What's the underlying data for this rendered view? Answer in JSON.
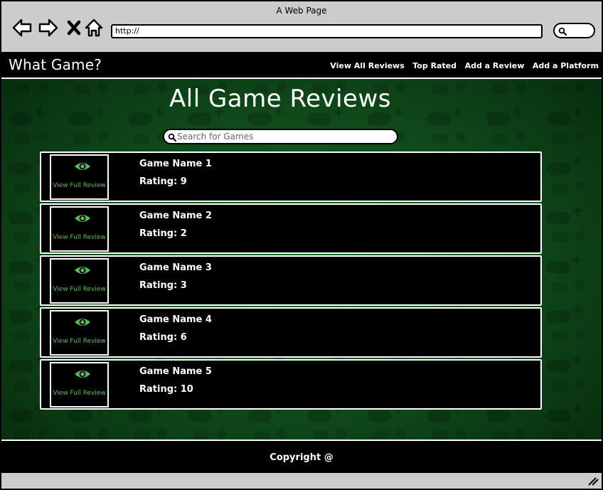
{
  "browser": {
    "title": "A Web Page",
    "url": "http://"
  },
  "site": {
    "logo": "What Game?",
    "nav": [
      {
        "label": "View All Reviews"
      },
      {
        "label": "Top Rated"
      },
      {
        "label": "Add a Review"
      },
      {
        "label": "Add a Platform"
      }
    ]
  },
  "main": {
    "title": "All Game Reviews",
    "search_placeholder": "Search for Games"
  },
  "reviews": [
    {
      "name": "Game Name 1",
      "rating": "Rating: 9",
      "link": "View Full Review"
    },
    {
      "name": "Game Name 2",
      "rating": "Rating: 2",
      "link": "View Full Review"
    },
    {
      "name": "Game Name 3",
      "rating": "Rating: 3",
      "link": "View Full Review"
    },
    {
      "name": "Game Name 4",
      "rating": "Rating: 6",
      "link": "View Full Review"
    },
    {
      "name": "Game Name 5",
      "rating": "Rating: 10",
      "link": "View Full Review"
    }
  ],
  "footer": {
    "text": "Copyright @"
  },
  "icons": {
    "back": "back-arrow-icon",
    "forward": "forward-arrow-icon",
    "stop": "close-icon",
    "home": "home-icon",
    "search": "search-icon",
    "review": "eye-icon"
  },
  "colors": {
    "accent": "#5cb85c",
    "background": "#0b3612",
    "header": "#000000"
  }
}
